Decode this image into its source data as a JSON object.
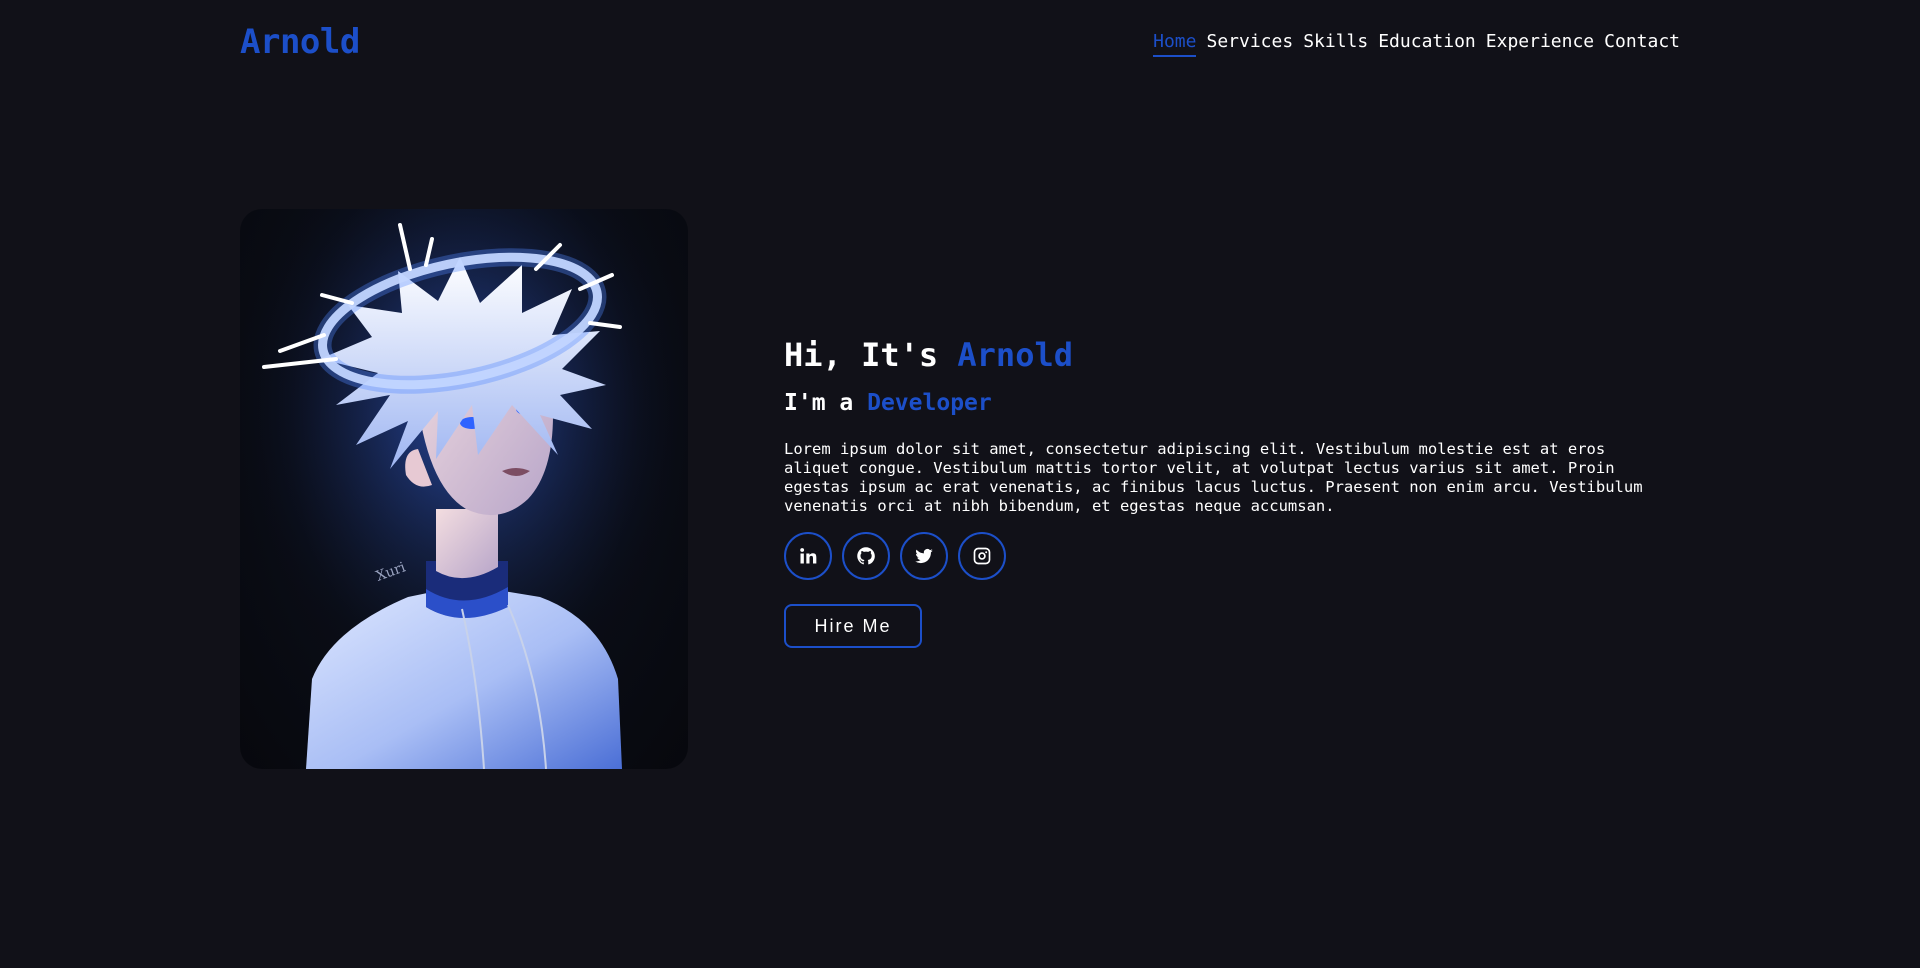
{
  "header": {
    "logo": "Arnold",
    "nav": [
      {
        "label": "Home",
        "active": true
      },
      {
        "label": "Services",
        "active": false
      },
      {
        "label": "Skills",
        "active": false
      },
      {
        "label": "Education",
        "active": false
      },
      {
        "label": "Experience",
        "active": false
      },
      {
        "label": "Contact",
        "active": false
      }
    ]
  },
  "hero": {
    "greeting_prefix": "Hi, It's",
    "name": "Arnold",
    "role_prefix": "I'm a",
    "role": "Developer",
    "bio": "Lorem ipsum dolor sit amet, consectetur adipiscing elit. Vestibulum molestie est at eros aliquet congue. Vestibulum mattis tortor velit, at volutpat lectus varius sit amet. Proin egestas ipsum ac erat venenatis, ac finibus lacus luctus. Praesent non enim arcu. Vestibulum venenatis orci at nibh bibendum, et egestas neque accumsan.",
    "socials": [
      {
        "icon": "linkedin-icon"
      },
      {
        "icon": "github-icon"
      },
      {
        "icon": "twitter-icon"
      },
      {
        "icon": "instagram-icon"
      }
    ],
    "hire_label": "Hire Me",
    "portrait_icon": "portrait-image"
  },
  "colors": {
    "background": "#111118",
    "accent": "#1c4fc9",
    "text": "#ffffff"
  }
}
